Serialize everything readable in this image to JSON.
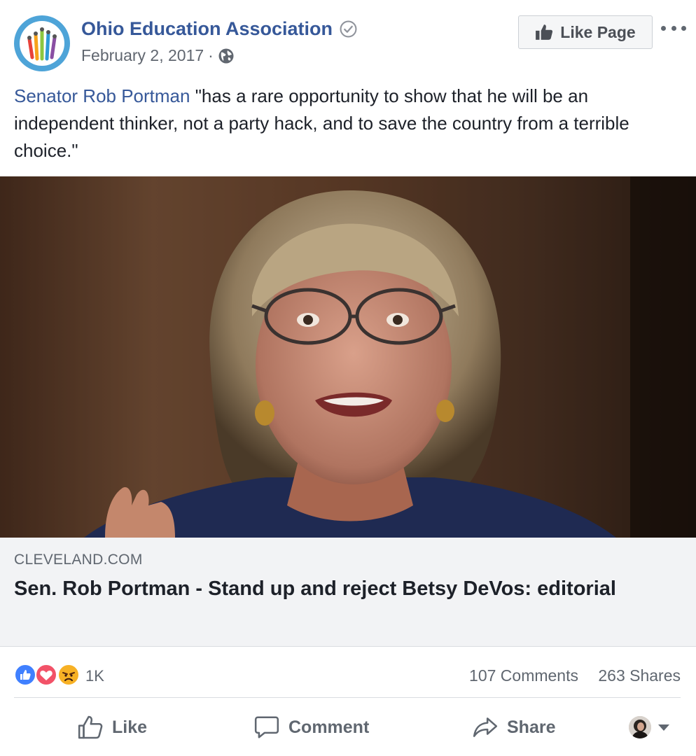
{
  "post": {
    "page_name": "Ohio Education Association",
    "date": "February 2, 2017",
    "meta_separator": "·",
    "like_page_label": "Like Page",
    "text": {
      "mention": "Senator Rob Portman",
      "body": " \"has a rare opportunity to show that he will be an independent thinker, not a party hack, and to save the country from a terrible choice.\""
    },
    "photo_icon": "photo-of-woman-speaking"
  },
  "link_card": {
    "domain": "CLEVELAND.COM",
    "title": "Sen. Rob Portman - Stand up and reject Betsy DeVos: editorial"
  },
  "engagement": {
    "reaction_icons": [
      "like-reaction-icon",
      "love-reaction-icon",
      "angry-reaction-icon"
    ],
    "reaction_count": "1K",
    "comments": "107 Comments",
    "shares": "263 Shares"
  },
  "actions": {
    "like_label": "Like",
    "comment_label": "Comment",
    "share_label": "Share"
  },
  "colors": {
    "link_blue": "#365899",
    "secondary_text": "#606770",
    "card_bg": "#f2f3f5",
    "like_blue": "#4080ff",
    "love_red": "#f25268",
    "angry_orange": "#f7b125"
  }
}
